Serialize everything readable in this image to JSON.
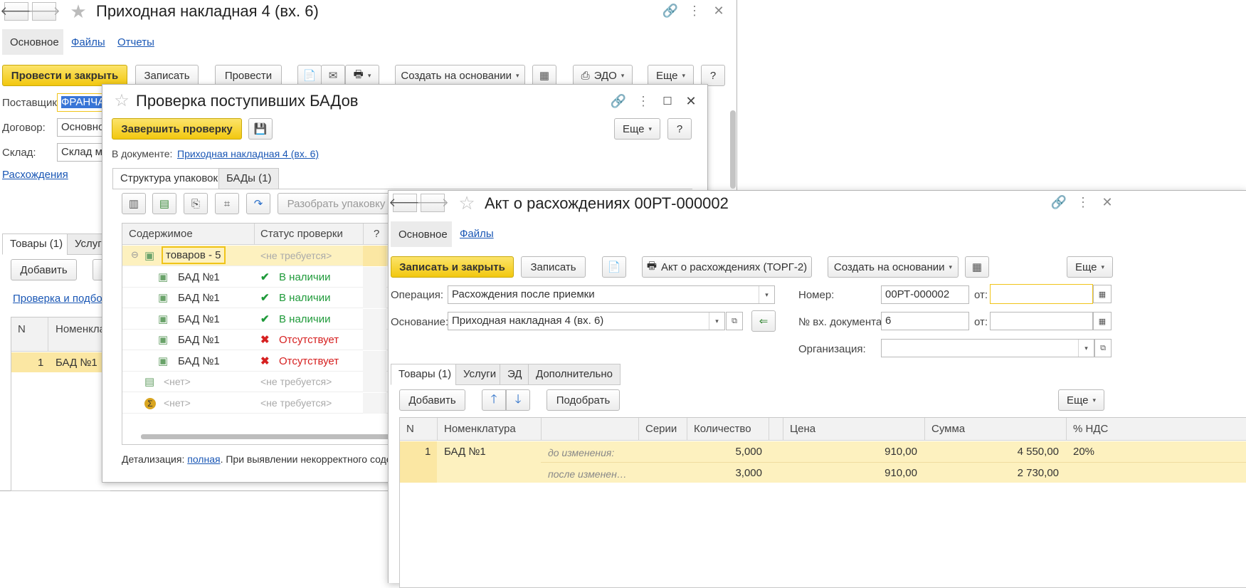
{
  "w1": {
    "title": "Приходная накладная 4 (вх. 6)",
    "tabs": [
      "Основное",
      "Файлы",
      "Отчеты"
    ],
    "btn_post_close": "Провести и закрыть",
    "btn_save": "Записать",
    "btn_post": "Провести",
    "btn_create": "Создать на основании",
    "btn_edo": "ЭДО",
    "btn_more": "Еще",
    "btn_help": "?",
    "supplier_label": "Поставщик:",
    "supplier_value": "ФРАНЧА",
    "contract_label": "Договор:",
    "contract_value": "Основно",
    "warehouse_label": "Склад:",
    "warehouse_value": "Склад ма",
    "discrepancy_link": "Расхождения",
    "tab_goods": "Товары (1)",
    "tab_services": "Услуги",
    "btn_add": "Добавить",
    "check_link": "Проверка и подбор",
    "col_n": "N",
    "col_nom": "Номенклатура",
    "row_n": "1",
    "row_nom": "БАД №1"
  },
  "w2": {
    "title": "Проверка поступивших БАДов",
    "btn_finish": "Завершить проверку",
    "btn_more": "Еще",
    "btn_help": "?",
    "doc_label": "В документе:",
    "doc_link": "Приходная накладная 4 (вх. 6)",
    "tab_struct": "Структура упаковок",
    "tab_bads": "БАДы (1)",
    "btn_unpack": "Разобрать упаковку",
    "col_content": "Содержимое",
    "col_status": "Статус проверки",
    "col_q": "?",
    "rows": [
      {
        "content": "товаров - 5",
        "status": "<не требуется>",
        "kind": "group"
      },
      {
        "content": "БАД №1",
        "status": "В наличии",
        "kind": "ok"
      },
      {
        "content": "БАД №1",
        "status": "В наличии",
        "kind": "ok"
      },
      {
        "content": "БАД №1",
        "status": "В наличии",
        "kind": "ok"
      },
      {
        "content": "БАД №1",
        "status": "Отсутствует",
        "kind": "miss"
      },
      {
        "content": "БАД №1",
        "status": "Отсутствует",
        "kind": "miss"
      },
      {
        "content": "<нет>",
        "status": "<не требуется>",
        "kind": "none"
      },
      {
        "content": "<нет>",
        "status": "<не требуется>",
        "kind": "sum"
      }
    ],
    "detail_label": "Детализация:",
    "detail_link": "полная",
    "detail_text": ". При выявлении некорректного соде"
  },
  "w3": {
    "title": "Акт о расхождениях 00РТ-000002",
    "tab_main": "Основное",
    "tab_files": "Файлы",
    "btn_save_close": "Записать и закрыть",
    "btn_save": "Записать",
    "btn_torg2": "Акт о расхождениях (ТОРГ-2)",
    "btn_create": "Создать на основании",
    "btn_more": "Еще",
    "op_label": "Операция:",
    "op_value": "Расхождения после приемки",
    "base_label": "Основание:",
    "base_value": "Приходная накладная 4 (вх. 6)",
    "num_label": "Номер:",
    "num_value": "00РТ-000002",
    "from_label": "от:",
    "indoc_label": "№ вх. документа:",
    "indoc_value": "6",
    "org_label": "Организация:",
    "tabs": [
      "Товары (1)",
      "Услуги",
      "ЭД",
      "Дополнительно"
    ],
    "btn_add": "Добавить",
    "btn_pick": "Подобрать",
    "btn_more2": "Еще",
    "cols": {
      "n": "N",
      "nom": "Номенклатура",
      "series": "Серии",
      "qty": "Количество",
      "price": "Цена",
      "sum": "Сумма",
      "vat": "% НДС"
    },
    "row": {
      "n": "1",
      "nom": "БАД №1",
      "before_label": "до изменения:",
      "after_label": "после изменен…",
      "qty_before": "5,000",
      "qty_after": "3,000",
      "price_before": "910,00",
      "price_after": "910,00",
      "sum_before": "4 550,00",
      "sum_after": "2 730,00",
      "vat": "20%"
    }
  },
  "colors": {
    "accent_yellow": "#f2c80f",
    "link_blue": "#1a57b5",
    "ok_green": "#1f9a3a",
    "miss_red": "#d62020",
    "row_highlight": "#fdf1bf"
  }
}
